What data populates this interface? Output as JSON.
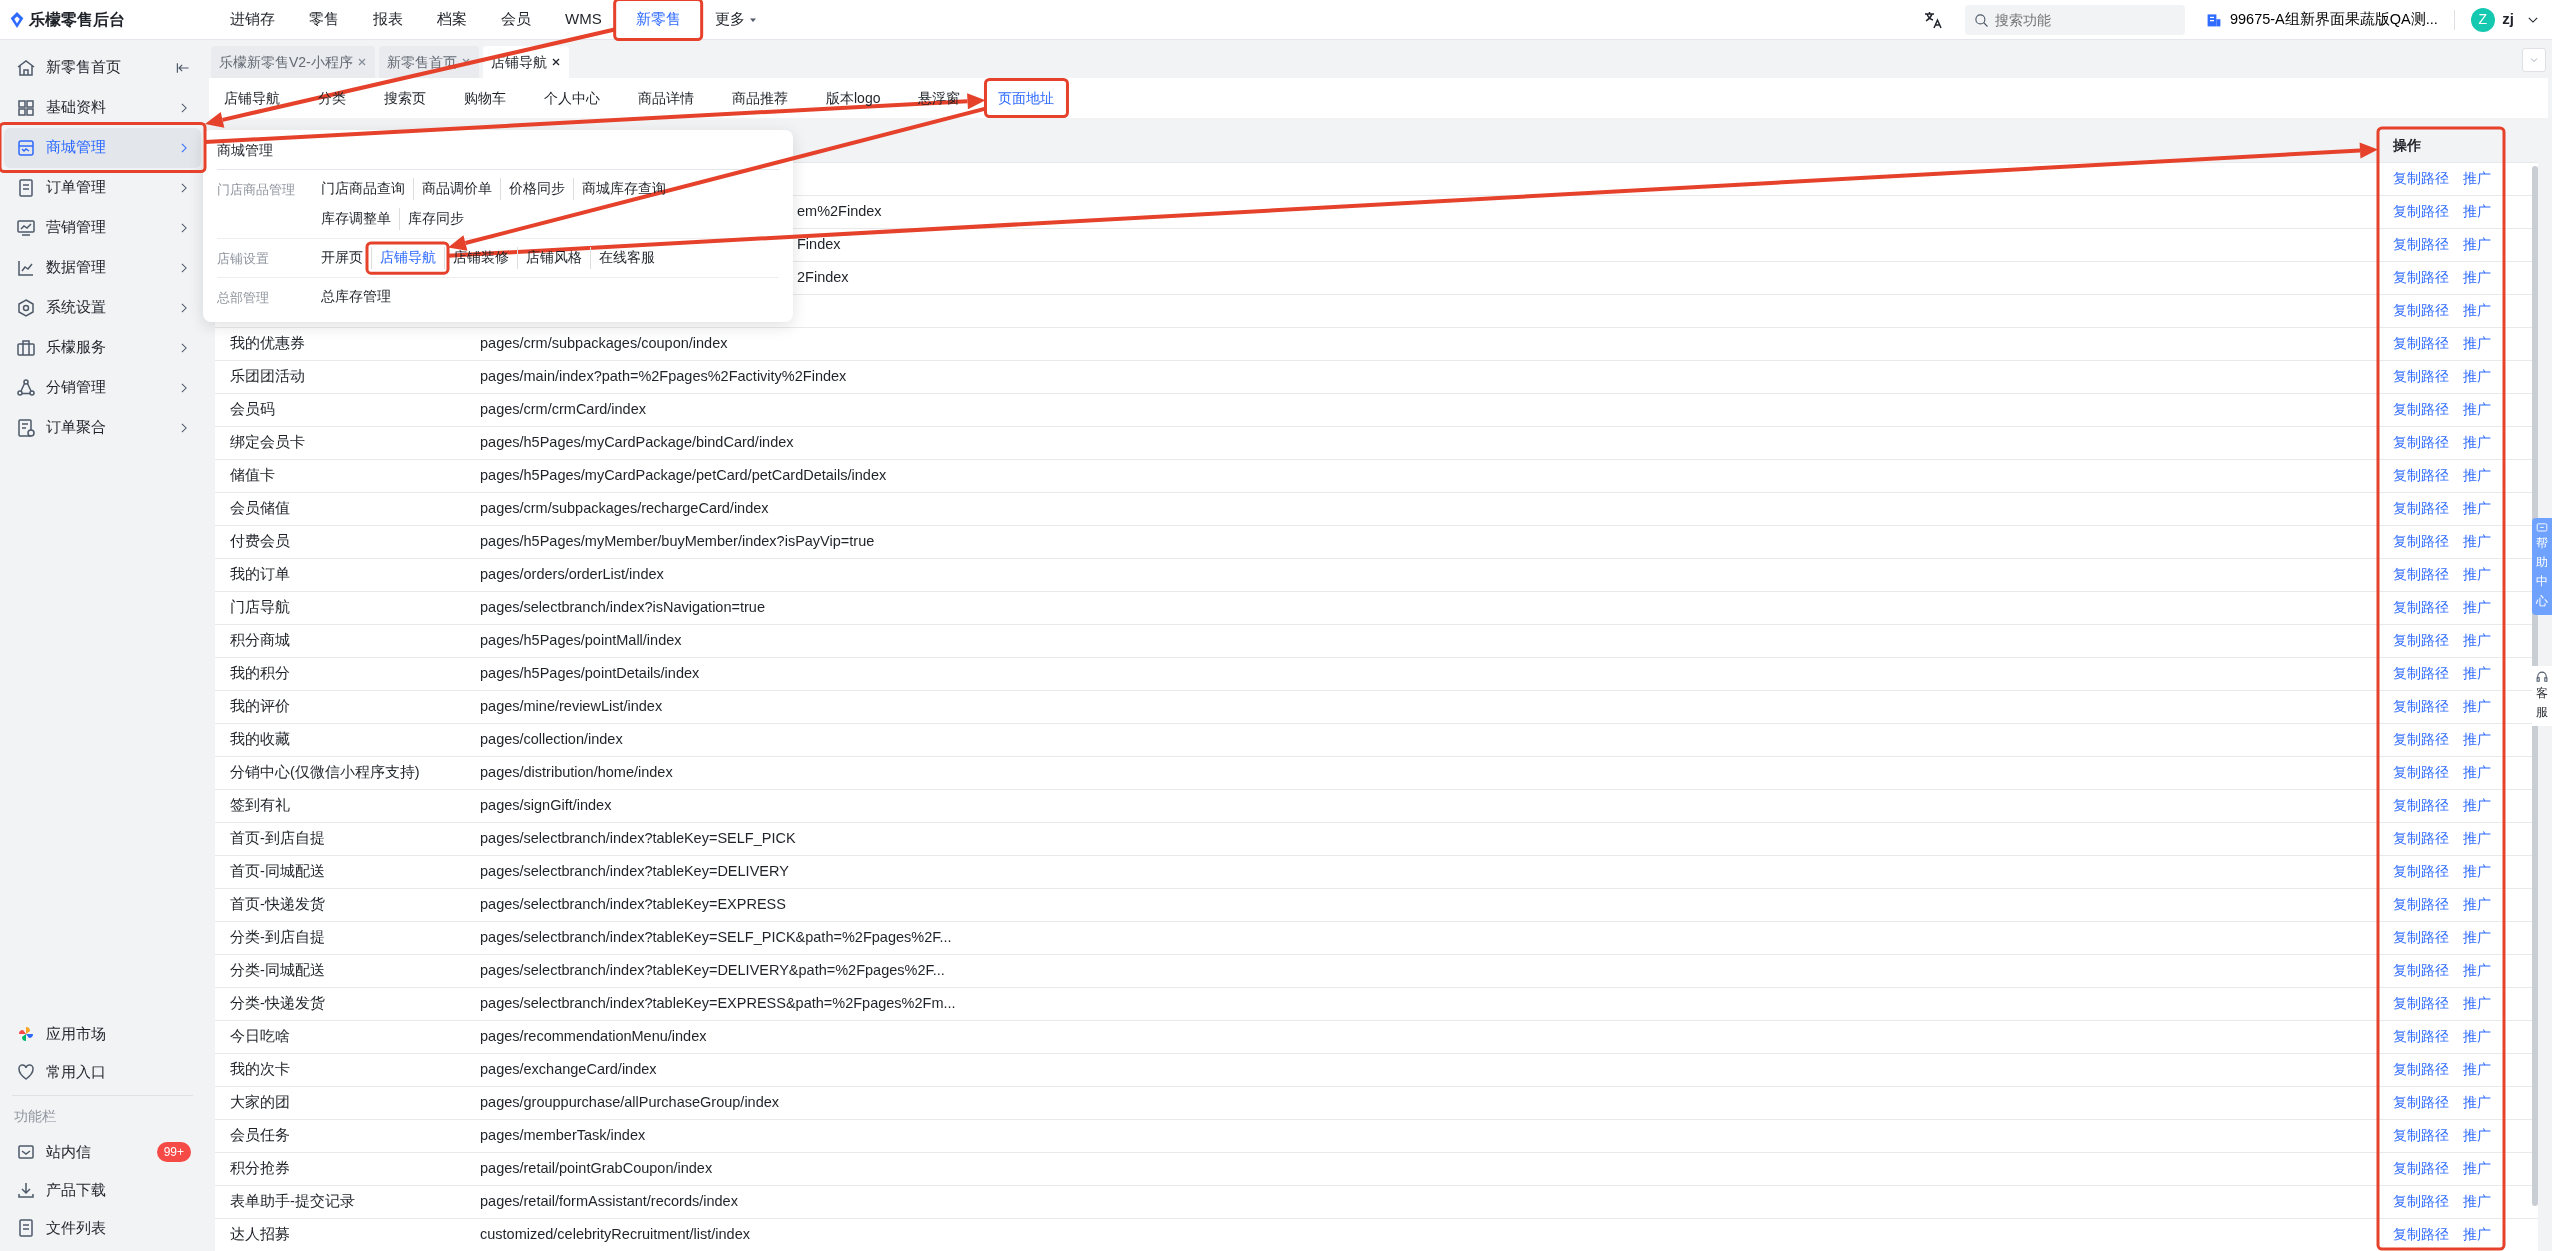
{
  "app": {
    "title": "乐檬零售后台"
  },
  "top_nav": [
    {
      "label": "进销存",
      "selected": false,
      "highlighted": false
    },
    {
      "label": "零售",
      "selected": false,
      "highlighted": false
    },
    {
      "label": "报表",
      "selected": false,
      "highlighted": false
    },
    {
      "label": "档案",
      "selected": false,
      "highlighted": false
    },
    {
      "label": "会员",
      "selected": false,
      "highlighted": false
    },
    {
      "label": "WMS",
      "selected": false,
      "highlighted": false
    },
    {
      "label": "新零售",
      "selected": true,
      "highlighted": true
    }
  ],
  "more_menu": {
    "label": "更多"
  },
  "header_right": {
    "search_placeholder": "搜索功能",
    "store": "99675-A组新界面果蔬版QA测...",
    "avatar": "Z",
    "user": "zj"
  },
  "sidebar": {
    "home": {
      "label": "新零售首页"
    },
    "items": [
      {
        "label": "基础资料",
        "selected": false,
        "highlighted": false
      },
      {
        "label": "商城管理",
        "selected": true,
        "highlighted": true
      },
      {
        "label": "订单管理",
        "selected": false,
        "highlighted": false
      },
      {
        "label": "营销管理",
        "selected": false,
        "highlighted": false
      },
      {
        "label": "数据管理",
        "selected": false,
        "highlighted": false
      },
      {
        "label": "系统设置",
        "selected": false,
        "highlighted": false
      },
      {
        "label": "乐檬服务",
        "selected": false,
        "highlighted": false
      },
      {
        "label": "分销管理",
        "selected": false,
        "highlighted": false
      },
      {
        "label": "订单聚合",
        "selected": false,
        "highlighted": false
      }
    ],
    "bottom_items": [
      {
        "label": "应用市场"
      },
      {
        "label": "常用入口"
      }
    ],
    "section_label": "功能栏",
    "tool_items": [
      {
        "label": "站内信",
        "badge": "99+"
      },
      {
        "label": "产品下载"
      },
      {
        "label": "文件列表"
      }
    ]
  },
  "page_tabs": [
    {
      "label": "乐檬新零售V2-小程序",
      "selected": false
    },
    {
      "label": "新零售首页",
      "selected": false
    },
    {
      "label": "店铺导航",
      "selected": true
    }
  ],
  "sub_tabs": [
    {
      "label": "店铺导航",
      "selected": false,
      "highlighted": false
    },
    {
      "label": "分类",
      "selected": false,
      "highlighted": false
    },
    {
      "label": "搜索页",
      "selected": false,
      "highlighted": false
    },
    {
      "label": "购物车",
      "selected": false,
      "highlighted": false
    },
    {
      "label": "个人中心",
      "selected": false,
      "highlighted": false
    },
    {
      "label": "商品详情",
      "selected": false,
      "highlighted": false
    },
    {
      "label": "商品推荐",
      "selected": false,
      "highlighted": false
    },
    {
      "label": "版本logo",
      "selected": false,
      "highlighted": false
    },
    {
      "label": "悬浮窗",
      "selected": false,
      "highlighted": false
    },
    {
      "label": "页面地址",
      "selected": true,
      "highlighted": true
    }
  ],
  "flyout_menu": {
    "title": "商城管理",
    "groups": [
      {
        "label": "门店商品管理",
        "lines": [
          [
            {
              "label": "门店商品查询",
              "selected": false,
              "highlighted": false
            },
            {
              "label": "商品调价单",
              "selected": false,
              "highlighted": false
            },
            {
              "label": "价格同步",
              "selected": false,
              "highlighted": false
            },
            {
              "label": "商城库存查询",
              "selected": false,
              "highlighted": false
            }
          ],
          [
            {
              "label": "库存调整单",
              "selected": false,
              "highlighted": false
            },
            {
              "label": "库存同步",
              "selected": false,
              "highlighted": false
            }
          ]
        ]
      },
      {
        "label": "店铺设置",
        "lines": [
          [
            {
              "label": "开屏页",
              "selected": false,
              "highlighted": false
            },
            {
              "label": "店铺导航",
              "selected": true,
              "highlighted": true
            },
            {
              "label": "店铺装修",
              "selected": false,
              "highlighted": false
            },
            {
              "label": "店铺风格",
              "selected": false,
              "highlighted": false
            },
            {
              "label": "在线客服",
              "selected": false,
              "highlighted": false
            }
          ]
        ]
      },
      {
        "label": "总部管理",
        "lines": [
          [
            {
              "label": "总库存管理",
              "selected": false,
              "highlighted": false
            }
          ]
        ]
      }
    ]
  },
  "table": {
    "action_column_title": "操作",
    "action_column_highlighted": true,
    "rows": [
      {
        "kind": "covered",
        "actions": [
          "复制路径",
          "推广"
        ]
      },
      {
        "kind": "covered",
        "path": "em%2Findex",
        "actions": [
          "复制路径",
          "推广"
        ]
      },
      {
        "kind": "covered",
        "path": "Findex",
        "actions": [
          "复制路径",
          "推广"
        ]
      },
      {
        "kind": "covered",
        "path": "2Findex",
        "actions": [
          "复制路径",
          "推广"
        ]
      },
      {
        "kind": "covered",
        "actions": [
          "复制路径",
          "推广"
        ]
      },
      {
        "kind": "full",
        "name": "我的优惠券",
        "path": "pages/crm/subpackages/coupon/index",
        "actions": [
          "复制路径",
          "推广"
        ]
      },
      {
        "kind": "full",
        "name": "乐团团活动",
        "path": "pages/main/index?path=%2Fpages%2Factivity%2Findex",
        "actions": [
          "复制路径",
          "推广"
        ]
      },
      {
        "kind": "full",
        "name": "会员码",
        "path": "pages/crm/crmCard/index",
        "actions": [
          "复制路径",
          "推广"
        ]
      },
      {
        "kind": "full",
        "name": "绑定会员卡",
        "path": "pages/h5Pages/myCardPackage/bindCard/index",
        "actions": [
          "复制路径",
          "推广"
        ]
      },
      {
        "kind": "full",
        "name": "储值卡",
        "path": "pages/h5Pages/myCardPackage/petCard/petCardDetails/index",
        "actions": [
          "复制路径",
          "推广"
        ]
      },
      {
        "kind": "full",
        "name": "会员储值",
        "path": "pages/crm/subpackages/rechargeCard/index",
        "actions": [
          "复制路径",
          "推广"
        ]
      },
      {
        "kind": "full",
        "name": "付费会员",
        "path": "pages/h5Pages/myMember/buyMember/index?isPayVip=true",
        "actions": [
          "复制路径",
          "推广"
        ]
      },
      {
        "kind": "full",
        "name": "我的订单",
        "path": "pages/orders/orderList/index",
        "actions": [
          "复制路径",
          "推广"
        ]
      },
      {
        "kind": "full",
        "name": "门店导航",
        "path": "pages/selectbranch/index?isNavigation=true",
        "actions": [
          "复制路径",
          "推广"
        ]
      },
      {
        "kind": "full",
        "name": "积分商城",
        "path": "pages/h5Pages/pointMall/index",
        "actions": [
          "复制路径",
          "推广"
        ]
      },
      {
        "kind": "full",
        "name": "我的积分",
        "path": "pages/h5Pages/pointDetails/index",
        "actions": [
          "复制路径",
          "推广"
        ]
      },
      {
        "kind": "full",
        "name": "我的评价",
        "path": "pages/mine/reviewList/index",
        "actions": [
          "复制路径",
          "推广"
        ]
      },
      {
        "kind": "full",
        "name": "我的收藏",
        "path": "pages/collection/index",
        "actions": [
          "复制路径",
          "推广"
        ]
      },
      {
        "kind": "full",
        "name": "分销中心(仅微信小程序支持)",
        "path": "pages/distribution/home/index",
        "actions": [
          "复制路径",
          "推广"
        ]
      },
      {
        "kind": "full",
        "name": "签到有礼",
        "path": "pages/signGift/index",
        "actions": [
          "复制路径",
          "推广"
        ]
      },
      {
        "kind": "full",
        "name": "首页-到店自提",
        "path": "pages/selectbranch/index?tableKey=SELF_PICK",
        "actions": [
          "复制路径",
          "推广"
        ]
      },
      {
        "kind": "full",
        "name": "首页-同城配送",
        "path": "pages/selectbranch/index?tableKey=DELIVERY",
        "actions": [
          "复制路径",
          "推广"
        ]
      },
      {
        "kind": "full",
        "name": "首页-快递发货",
        "path": "pages/selectbranch/index?tableKey=EXPRESS",
        "actions": [
          "复制路径",
          "推广"
        ]
      },
      {
        "kind": "full",
        "name": "分类-到店自提",
        "path": "pages/selectbranch/index?tableKey=SELF_PICK&path=%2Fpages%2F...",
        "actions": [
          "复制路径",
          "推广"
        ]
      },
      {
        "kind": "full",
        "name": "分类-同城配送",
        "path": "pages/selectbranch/index?tableKey=DELIVERY&path=%2Fpages%2F...",
        "actions": [
          "复制路径",
          "推广"
        ]
      },
      {
        "kind": "full",
        "name": "分类-快递发货",
        "path": "pages/selectbranch/index?tableKey=EXPRESS&path=%2Fpages%2Fm...",
        "actions": [
          "复制路径",
          "推广"
        ]
      },
      {
        "kind": "full",
        "name": "今日吃啥",
        "path": "pages/recommendationMenu/index",
        "actions": [
          "复制路径",
          "推广"
        ]
      },
      {
        "kind": "full",
        "name": "我的次卡",
        "path": "pages/exchangeCard/index",
        "actions": [
          "复制路径",
          "推广"
        ]
      },
      {
        "kind": "full",
        "name": "大家的团",
        "path": "pages/grouppurchase/allPurchaseGroup/index",
        "actions": [
          "复制路径",
          "推广"
        ]
      },
      {
        "kind": "full",
        "name": "会员任务",
        "path": "pages/memberTask/index",
        "actions": [
          "复制路径",
          "推广"
        ]
      },
      {
        "kind": "full",
        "name": "积分抢券",
        "path": "pages/retail/pointGrabCoupon/index",
        "actions": [
          "复制路径",
          "推广"
        ]
      },
      {
        "kind": "full",
        "name": "表单助手-提交记录",
        "path": "pages/retail/formAssistant/records/index",
        "actions": [
          "复制路径",
          "推广"
        ]
      },
      {
        "kind": "full",
        "name": "达人招募",
        "path": "customized/celebrityRecruitment/list/index",
        "actions": [
          "复制路径",
          "推广"
        ]
      }
    ]
  },
  "help_widget": {
    "help": "帮助中心",
    "service": "客服"
  }
}
